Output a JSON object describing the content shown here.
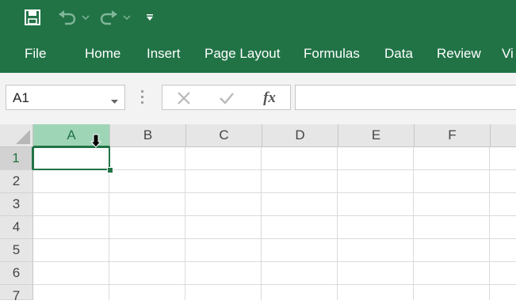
{
  "app": {
    "accent": "#217346",
    "grid_line": "#dadada",
    "header_bg": "#e6e6e6"
  },
  "quick_access": {
    "icons": [
      "save-icon",
      "undo-icon",
      "undo-dropdown-icon",
      "redo-icon",
      "redo-dropdown-icon",
      "customize-toolbar-icon"
    ]
  },
  "ribbon": {
    "tabs": [
      "File",
      "Home",
      "Insert",
      "Page Layout",
      "Formulas",
      "Data",
      "Review",
      "Vi"
    ]
  },
  "formula_bar": {
    "name_box": "A1",
    "fx_label": "fx",
    "formula": ""
  },
  "grid": {
    "columns": [
      "A",
      "B",
      "C",
      "D",
      "E",
      "F"
    ],
    "rows": [
      "1",
      "2",
      "3",
      "4",
      "5",
      "6",
      "7"
    ],
    "active_cell": "A1",
    "active_cell_value": ""
  }
}
